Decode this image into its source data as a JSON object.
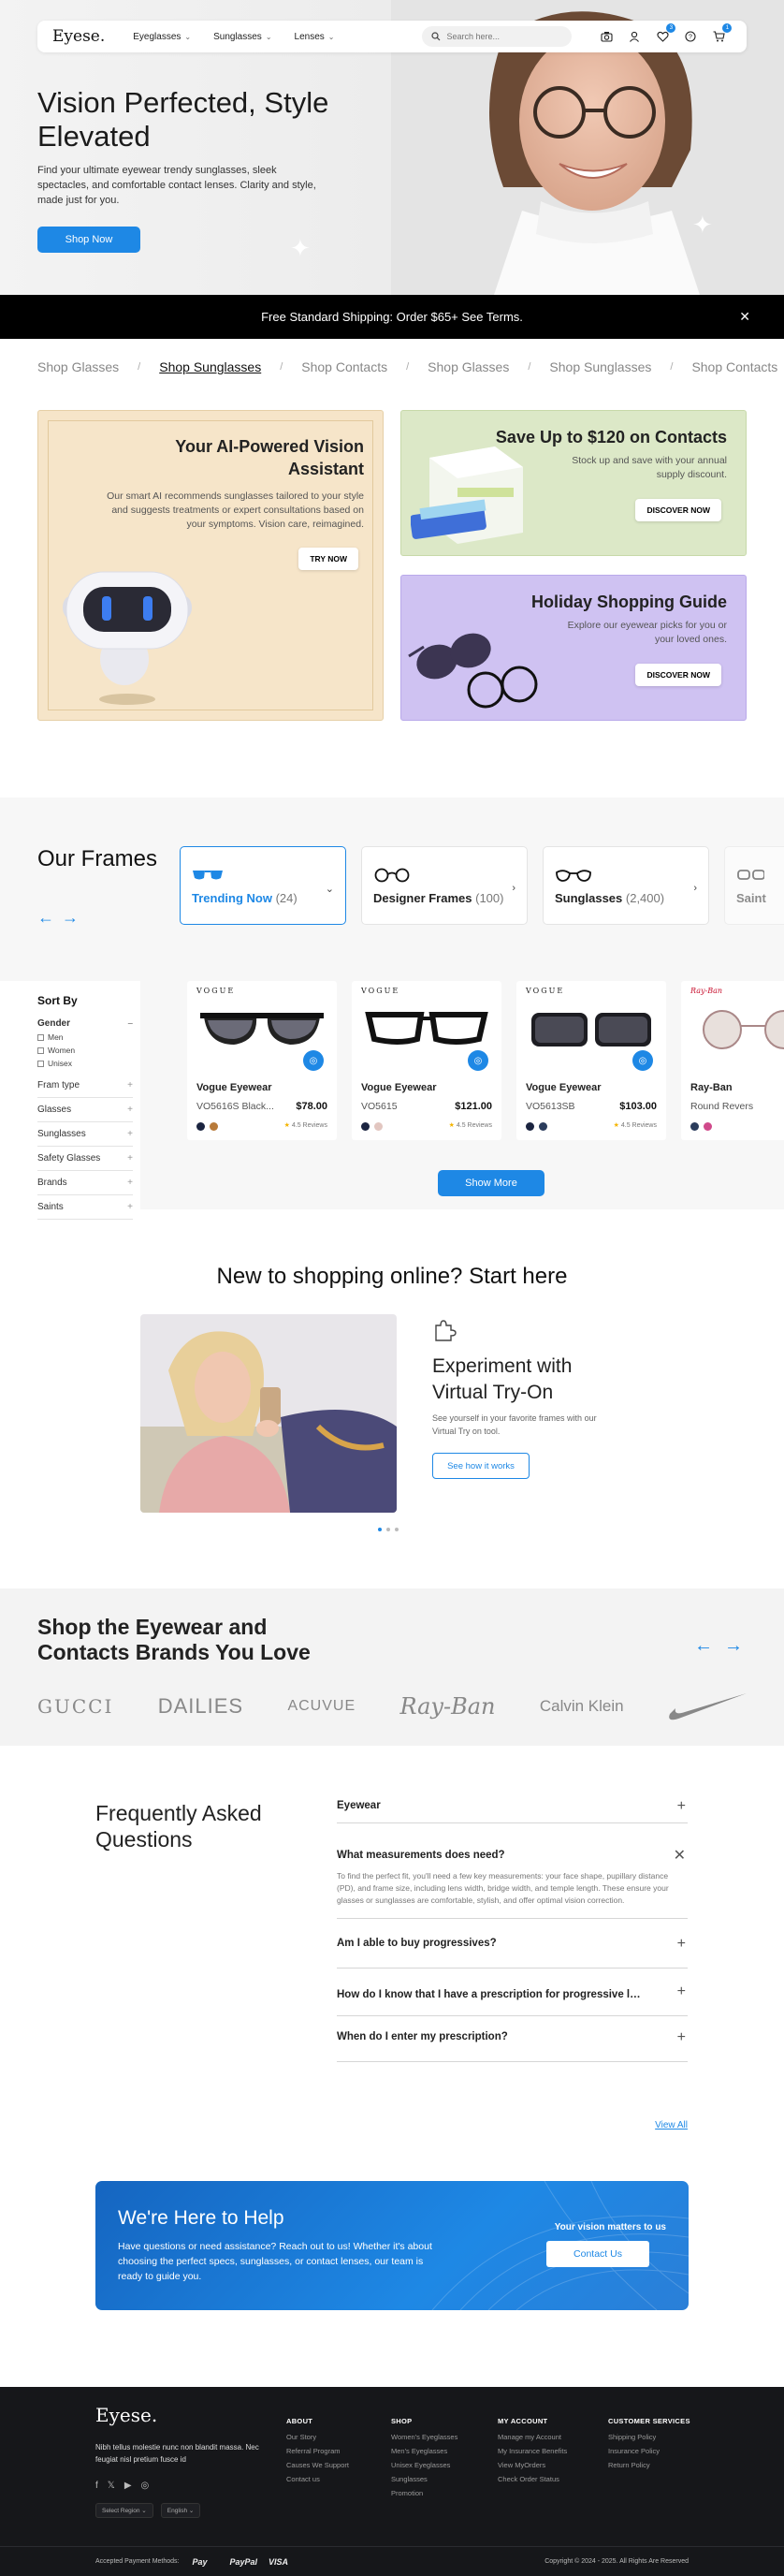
{
  "nav": {
    "logo": "Eyese.",
    "links": [
      "Eyeglasses",
      "Sunglasses",
      "Lenses"
    ],
    "search_placeholder": "Search here...",
    "wishlist_count": "3",
    "cart_count": "1"
  },
  "hero": {
    "title": "Vision Perfected, Style Elevated",
    "subtitle": "Find your ultimate eyewear trendy sunglasses, sleek spectacles, and comfortable contact lenses. Clarity and style, made just for you.",
    "cta": "Shop Now"
  },
  "shipping": {
    "text": "Free Standard Shipping: Order $65+ See Terms.",
    "close": "✕"
  },
  "categories": {
    "items": [
      "Shop Glasses",
      "Shop Sunglasses",
      "Shop Contacts",
      "Shop Glasses",
      "Shop Sunglasses",
      "Shop Contacts"
    ],
    "active_index": 1
  },
  "promos": {
    "ai": {
      "title": "Your AI-Powered Vision Assistant",
      "text": "Our smart AI recommends sunglasses tailored to your style and suggests treatments or expert consultations based on your symptoms. Vision care, reimagined.",
      "cta": "TRY NOW"
    },
    "contacts": {
      "title": "Save Up to $120 on Contacts",
      "text": "Stock up and save with your annual supply discount.",
      "cta": "DISCOVER NOW"
    },
    "holiday": {
      "title": "Holiday Shopping Guide",
      "text": "Explore our eyewear picks  for you or your loved ones.",
      "cta": "DISCOVER NOW"
    }
  },
  "frames": {
    "title": "Our Frames",
    "tabs": [
      {
        "label": "Trending Now",
        "count": "(24)",
        "icon": "sunglasses-icon"
      },
      {
        "label": "Designer Frames",
        "count": "(100)",
        "icon": "round-glasses-icon"
      },
      {
        "label": "Sunglasses",
        "count": "(2,400)",
        "icon": "sunglasses-icon"
      },
      {
        "label": "Saint",
        "count": "",
        "icon": "glasses-icon"
      }
    ],
    "sort_by": "Sort By",
    "filters": {
      "gender_label": "Gender",
      "gender_options": [
        "Men",
        "Women",
        "Unisex"
      ],
      "groups": [
        "Fram type",
        "Glasses",
        "Sunglasses",
        "Safety Glasses",
        "Brands",
        "Saints"
      ]
    },
    "products": [
      {
        "brand_logo": "VOGUE",
        "name": "Vogue Eyewear",
        "model": "VO5616S Black...",
        "price": "$78.00",
        "reviews": "4.5 Reviews",
        "swatches": [
          "#1b2440",
          "#b87a3a"
        ]
      },
      {
        "brand_logo": "VOGUE",
        "name": "Vogue Eyewear",
        "model": "VO5615",
        "price": "$121.00",
        "reviews": "4.5 Reviews",
        "swatches": [
          "#1b2440",
          "#e2c6c0"
        ]
      },
      {
        "brand_logo": "VOGUE",
        "name": "Vogue Eyewear",
        "model": "VO5613SB",
        "price": "$103.00",
        "reviews": "4.5 Reviews",
        "swatches": [
          "#1b2440",
          "#2b3c5c"
        ]
      },
      {
        "brand_logo": "Ray-Ban",
        "name": "Ray-Ban",
        "model": "Round Revers",
        "price": "",
        "reviews": "",
        "swatches": [
          "#2b3c5c",
          "#d04a8b"
        ]
      }
    ],
    "show_more": "Show More"
  },
  "newshop": {
    "title": "New to shopping online? Start here",
    "feature_title": "Experiment with Virtual  Try-On",
    "feature_text": "See yourself in your favorite frames with our Virtual Try on tool.",
    "cta": "See how it works"
  },
  "brands": {
    "title": "Shop the Eyewear and Contacts Brands You Love",
    "items": [
      "GUCCI",
      "DAILIES",
      "ACUVUE",
      "Ray-Ban",
      "Calvin Klein",
      "Nike"
    ]
  },
  "faq": {
    "title": "Frequently Asked Questions",
    "items": [
      {
        "q": "Eyewear",
        "open": false,
        "a": ""
      },
      {
        "q": "What measurements does need?",
        "open": true,
        "a": "To find the perfect fit, you'll need a few key measurements: your face shape, pupillary distance (PD), and frame size, including lens width, bridge width, and temple length. These ensure your glasses or sunglasses are comfortable, stylish, and offer optimal vision correction."
      },
      {
        "q": "Am I able to buy progressives?",
        "open": false,
        "a": ""
      },
      {
        "q": "How do I know that I have a prescription for progressive lenses?",
        "open": false,
        "a": ""
      },
      {
        "q": "When do I enter my prescription?",
        "open": false,
        "a": ""
      }
    ],
    "view_all": "View All"
  },
  "help": {
    "title": "We're Here to Help",
    "text": "Have questions or need assistance? Reach out to us! Whether it's about choosing the perfect specs, sunglasses, or contact lenses, our team is ready to guide you.",
    "tagline": "Your vision matters to us",
    "cta": "Contact Us"
  },
  "footer": {
    "logo": "Eyese.",
    "text": "Nibh tellus molestie nunc non blandit massa. Nec feugiat nisl pretium fusce id",
    "region": "Select Region",
    "language": "English",
    "columns": [
      {
        "heading": "ABOUT",
        "links": [
          "Our Story",
          "Referral Program",
          "Causes We Support",
          "Contact us"
        ]
      },
      {
        "heading": "SHOP",
        "links": [
          "Women's Eyeglasses",
          "Men's Eyeglasses",
          "Unisex Eyeglasses",
          "Sunglasses",
          "Promotion"
        ]
      },
      {
        "heading": "MY ACCOUNT",
        "links": [
          "Manage my Account",
          "My Insurance Benefits",
          "View MyOrders",
          "Check Order Status"
        ]
      },
      {
        "heading": "CUSTOMER SERVICES",
        "links": [
          "Shipping Policy",
          "Insurance Policy",
          "Return Policy"
        ]
      }
    ],
    "payments_label": "Accepted Payment Methods:",
    "payments": [
      "Pay",
      "",
      "PayPal",
      "VISA"
    ],
    "copyright": "Copyright © 2024 - 2025. All Rights Are Reserved"
  },
  "colors": {
    "accent": "#1e88e5",
    "dark": "#16171a",
    "ai_tile": "#f6e5c9",
    "contacts_tile": "#dce8c7",
    "holiday_tile": "#cfc2f2"
  }
}
